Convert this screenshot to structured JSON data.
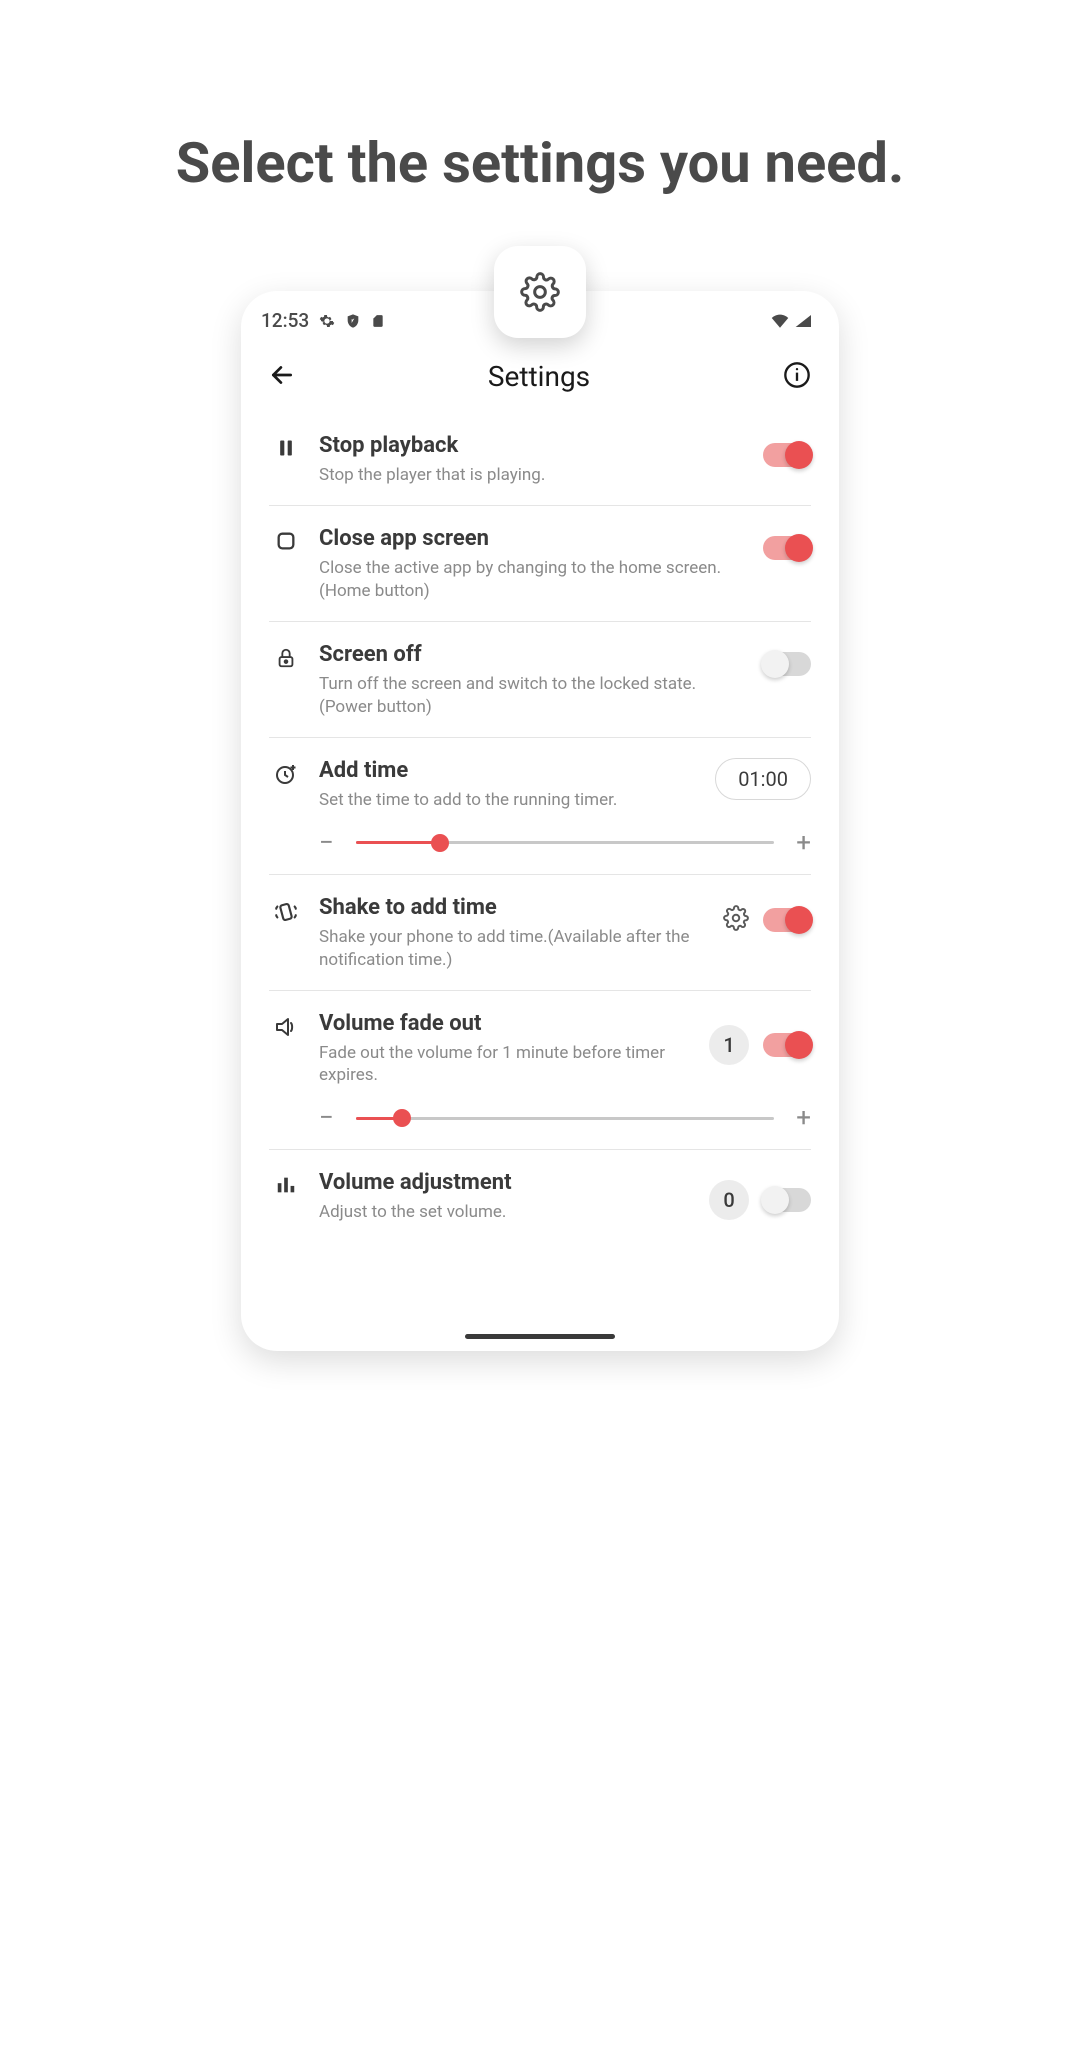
{
  "headline": "Select the settings you need.",
  "statusbar": {
    "time": "12:53"
  },
  "appbar": {
    "title": "Settings"
  },
  "rows": {
    "stop_playback": {
      "title": "Stop playback",
      "desc": "Stop the player that is playing.",
      "on": true
    },
    "close_app": {
      "title": "Close app screen",
      "desc": "Close the active app by changing to the home screen.(Home button)",
      "on": true
    },
    "screen_off": {
      "title": "Screen off",
      "desc": "Turn off the screen and switch to the locked state.(Power button)",
      "on": false
    },
    "add_time": {
      "title": "Add time",
      "desc": "Set the time to add to the running timer.",
      "value": "01:00",
      "slider_pct": 20
    },
    "shake": {
      "title": "Shake to add time",
      "desc": "Shake your phone to add time.(Available after the notification time.)",
      "on": true
    },
    "fade": {
      "title": "Volume fade out",
      "desc": "Fade out the volume for 1 minute before timer expires.",
      "badge": "1",
      "on": true,
      "slider_pct": 11
    },
    "vol_adj": {
      "title": "Volume adjustment",
      "desc": "Adjust to the set volume.",
      "badge": "0",
      "on": false
    }
  },
  "glyph": {
    "minus": "−",
    "plus": "+"
  }
}
